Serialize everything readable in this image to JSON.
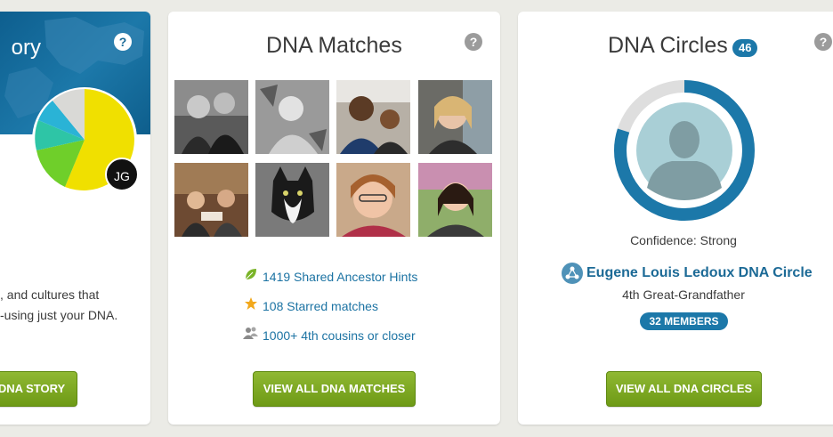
{
  "story_card": {
    "title_fragment": "ory",
    "help_icon": "?",
    "avatar_initials": "JG",
    "text_lines": [
      ", and cultures that",
      "-using just your DNA."
    ],
    "button_label": "DNA STORY",
    "ethnicity_colors": [
      "#f0e000",
      "#6fcf2a",
      "#2ec5a6",
      "#2ab3d6",
      "#d9d9d6"
    ]
  },
  "matches_card": {
    "title": "DNA Matches",
    "help_icon": "?",
    "photos": [
      {
        "icon": "couple-photo"
      },
      {
        "icon": "vintage-woman-photo"
      },
      {
        "icon": "couple-selfie-photo"
      },
      {
        "icon": "woman-car-photo"
      },
      {
        "icon": "family-photo"
      },
      {
        "icon": "cat-photo"
      },
      {
        "icon": "woman-glasses-photo"
      },
      {
        "icon": "woman-outdoor-photo"
      }
    ],
    "stats": [
      {
        "icon": "leaf-icon",
        "text": "1419 Shared Ancestor Hints"
      },
      {
        "icon": "star-icon",
        "text": "108 Starred matches"
      },
      {
        "icon": "people-icon",
        "text": "1000+ 4th cousins or closer"
      }
    ],
    "button_label": "VIEW ALL DNA MATCHES"
  },
  "circles_card": {
    "title": "DNA Circles",
    "count": "46",
    "help_icon": "?",
    "confidence": "Confidence: Strong",
    "confidence_fraction": 0.8,
    "circle_name": "Eugene Louis Ledoux DNA Circle",
    "relation": "4th Great-Grandfather",
    "members_badge": "32 MEMBERS",
    "button_label": "VIEW ALL DNA CIRCLES",
    "accent_color": "#1c78a9",
    "button_color": "#7aa821"
  }
}
